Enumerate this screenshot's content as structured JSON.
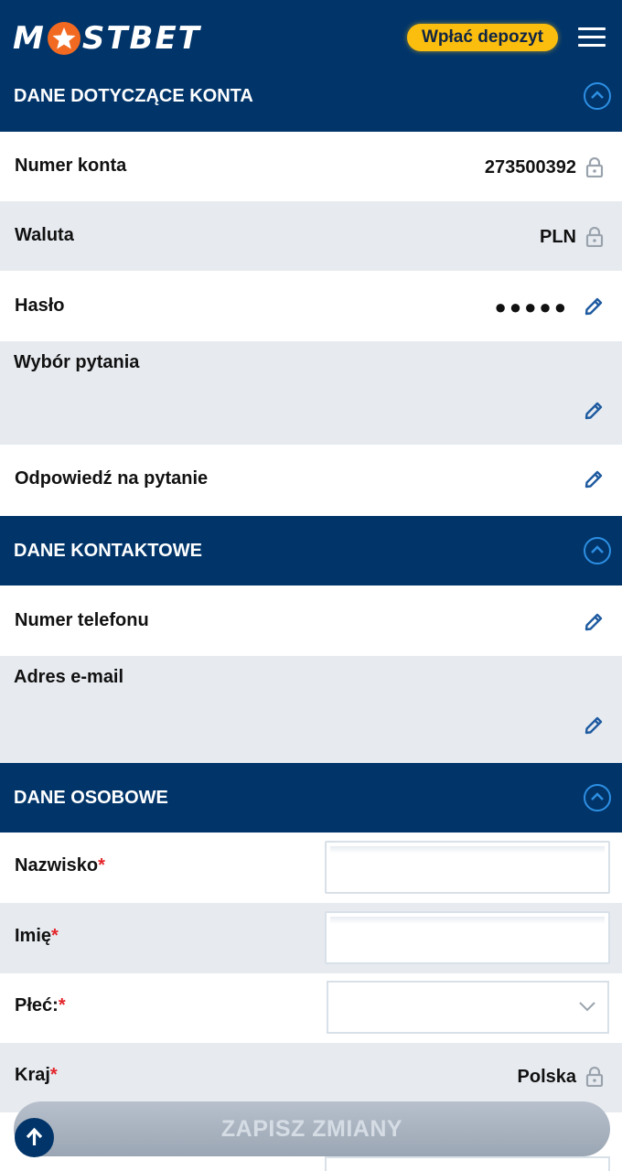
{
  "header": {
    "logo_text_left": "M",
    "logo_text_right": "STBET",
    "deposit_label": "Wpłać depozyt",
    "brand_color": "#01356a",
    "accent_color": "#fbbe0e"
  },
  "sections": {
    "account": {
      "title": "DANE DOTYCZĄCE KONTA",
      "rows": {
        "account_number": {
          "label": "Numer konta",
          "value": "273500392"
        },
        "currency": {
          "label": "Waluta",
          "value": "PLN"
        },
        "password": {
          "label": "Hasło",
          "value": "●●●●●"
        },
        "question": {
          "label": "Wybór pytania"
        },
        "answer": {
          "label": "Odpowiedź na pytanie"
        }
      }
    },
    "contact": {
      "title": "DANE KONTAKTOWE",
      "rows": {
        "phone": {
          "label": "Numer telefonu"
        },
        "email": {
          "label": "Adres e-mail"
        }
      }
    },
    "personal": {
      "title": "DANE OSOBOWE",
      "rows": {
        "surname": {
          "label": "Nazwisko",
          "required": "*",
          "value": ""
        },
        "first_name": {
          "label": "Imię",
          "required": "*",
          "value": ""
        },
        "gender": {
          "label": "Płeć:",
          "required": "*",
          "selected": ""
        },
        "country": {
          "label": "Kraj",
          "required": "*",
          "value": "Polska"
        }
      }
    }
  },
  "footer": {
    "save_label": "ZAPISZ ZMIANY"
  },
  "icons": [
    "menu-icon",
    "chevron-up-icon",
    "lock-icon",
    "pencil-icon",
    "chevron-down-icon",
    "arrow-up-icon"
  ]
}
